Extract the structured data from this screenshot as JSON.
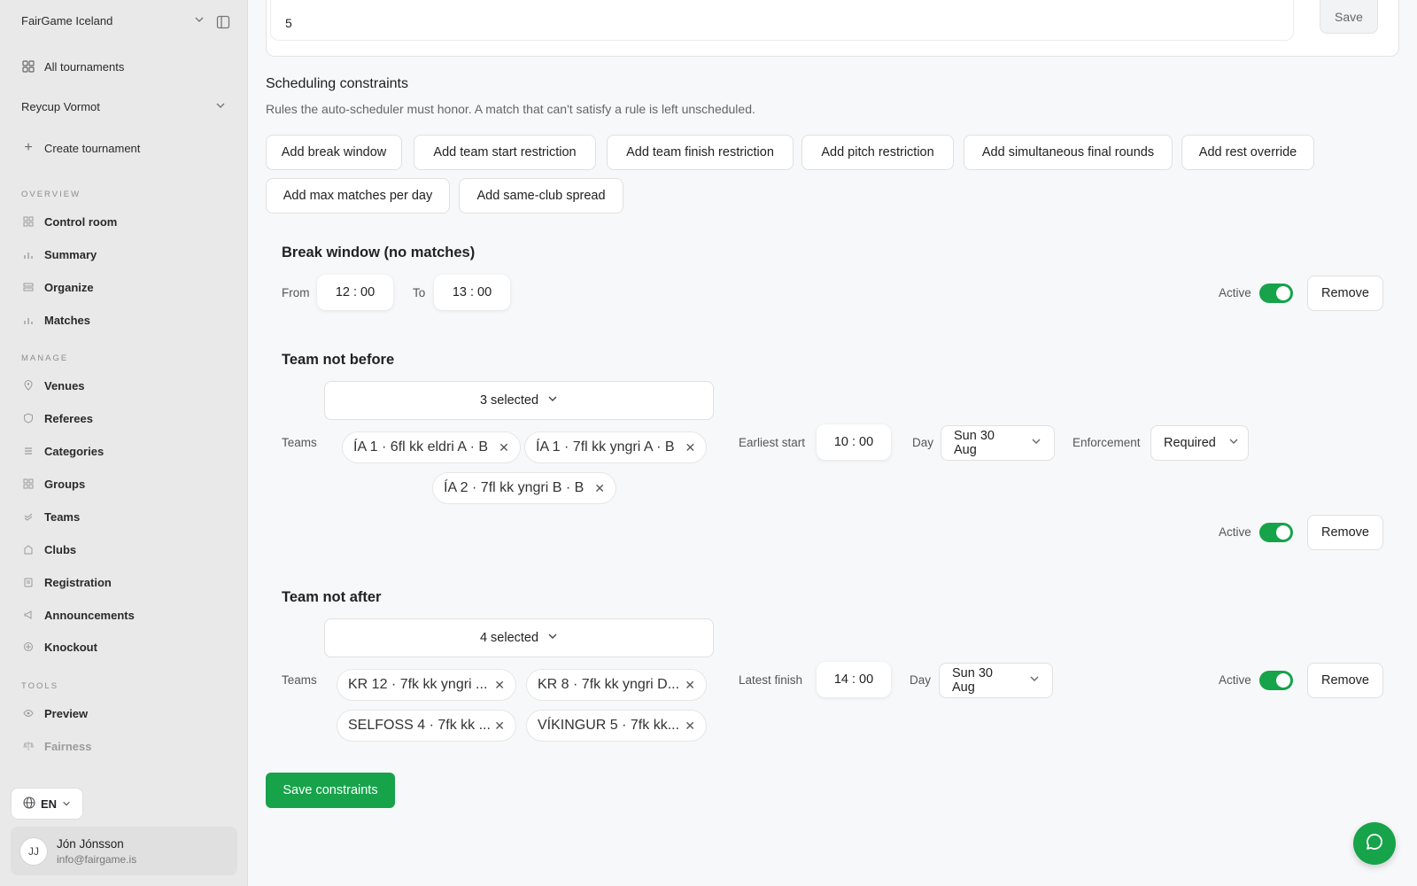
{
  "sidebar": {
    "org_name": "FairGame Iceland",
    "all_tournaments": "All tournaments",
    "tournament_name": "Reycup Vormot",
    "create_tournament": "Create tournament",
    "sections": {
      "overview": "OVERVIEW",
      "manage": "MANAGE",
      "tools": "TOOLS"
    },
    "overview_items": [
      "Control room",
      "Summary",
      "Organize",
      "Matches"
    ],
    "manage_items": [
      "Venues",
      "Referees",
      "Categories",
      "Groups",
      "Teams",
      "Clubs",
      "Registration",
      "Announcements",
      "Knockout"
    ],
    "tools_items": [
      "Preview",
      "Fairness"
    ],
    "language": "EN",
    "user": {
      "initials": "JJ",
      "name": "Jón Jónsson",
      "email": "info@fairgame.is"
    }
  },
  "top": {
    "value": "5",
    "save": "Save"
  },
  "constraints": {
    "title": "Scheduling constraints",
    "subtitle": "Rules the auto-scheduler must honor. A match that can't satisfy a rule is left unscheduled.",
    "add_buttons": [
      "Add break window",
      "Add team start restriction",
      "Add team finish restriction",
      "Add pitch restriction",
      "Add simultaneous final rounds",
      "Add rest override",
      "Add max matches per day",
      "Add same-club spread"
    ]
  },
  "break_window": {
    "title": "Break window (no matches)",
    "from_label": "From",
    "from_time": "12 : 00",
    "to_label": "To",
    "to_time": "13 : 00",
    "active_label": "Active",
    "active": true,
    "remove": "Remove"
  },
  "not_before": {
    "title": "Team not before",
    "selected": "3 selected",
    "teams_label": "Teams",
    "teams": [
      "ÍA 1 · 6fl kk eldri A · B",
      "ÍA 1 · 7fl kk yngri A · B",
      "ÍA 2 · 7fl kk yngri B · B"
    ],
    "time_label": "Earliest start",
    "time": "10 : 00",
    "day_label": "Day",
    "day": "Sun 30 Aug",
    "enforcement_label": "Enforcement",
    "enforcement": "Required",
    "active_label": "Active",
    "active": true,
    "remove": "Remove"
  },
  "not_after": {
    "title": "Team not after",
    "selected": "4 selected",
    "teams_label": "Teams",
    "teams": [
      "KR 12 · 7fk kk yngri ...",
      "KR 8 · 7fk kk yngri D...",
      "SELFOSS 4 · 7fk kk ...",
      "VÍKINGUR 5 · 7fk kk..."
    ],
    "time_label": "Latest finish",
    "time": "14 : 00",
    "day_label": "Day",
    "day": "Sun 30 Aug",
    "active_label": "Active",
    "active": true,
    "remove": "Remove"
  },
  "save_constraints": "Save constraints",
  "colors": {
    "accent": "#16a34a",
    "sidebar_bg": "#e9e9e9",
    "page_bg": "#f7f8fa"
  }
}
